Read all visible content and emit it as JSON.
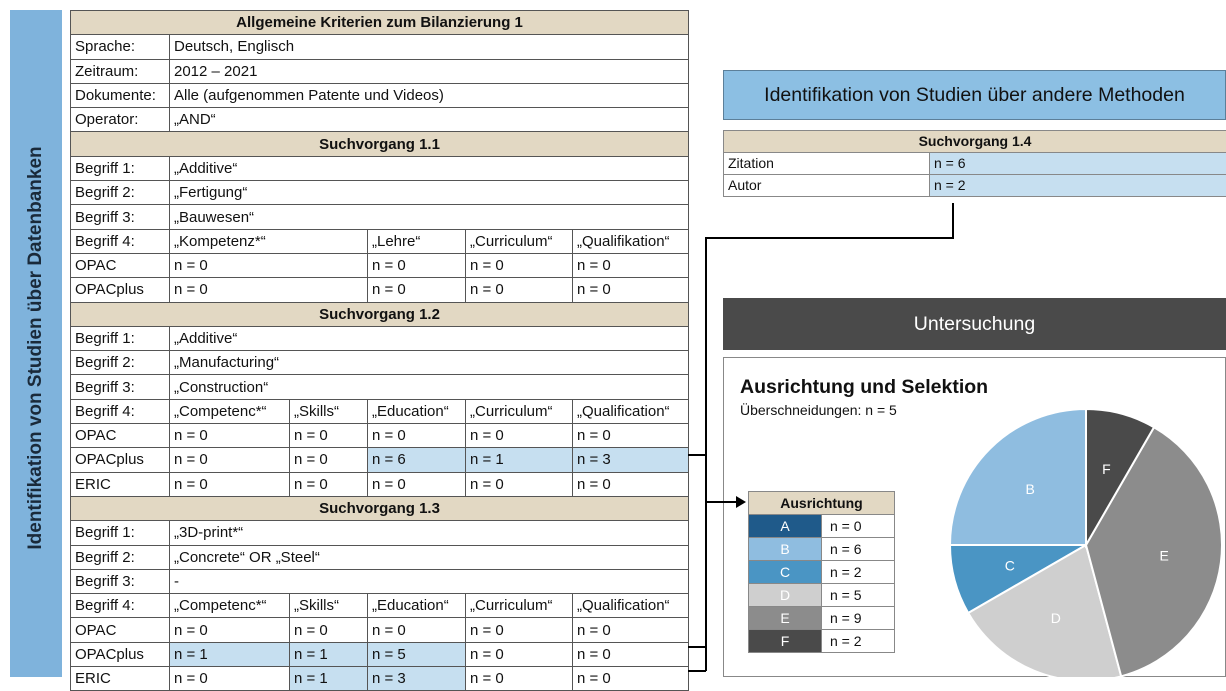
{
  "side_label": "Identifikation von Studien über Datenbanken",
  "main_table": {
    "title": "Allgemeine Kriterien zum Bilanzierung 1",
    "criteria": [
      {
        "label": "Sprache:",
        "value": "Deutsch, Englisch"
      },
      {
        "label": "Zeitraum:",
        "value": "2012 – 2021"
      },
      {
        "label": "Dokumente:",
        "value": "Alle (aufgenommen Patente und Videos)"
      },
      {
        "label": "Operator:",
        "value": "„AND“"
      }
    ],
    "sections": [
      {
        "title": "Suchvorgang 1.1",
        "terms": [
          {
            "label": "Begriff 1:",
            "value": "„Additive“"
          },
          {
            "label": "Begriff 2:",
            "value": "„Fertigung“"
          },
          {
            "label": "Begriff 3:",
            "value": "„Bauwesen“"
          }
        ],
        "term4": {
          "label": "Begriff 4:",
          "cells": [
            "„Kompetenz*“",
            "„Lehre“",
            "„Curriculum“",
            "„Qualifikation“"
          ]
        },
        "results": [
          {
            "db": "OPAC",
            "cells": [
              "n = 0",
              "n = 0",
              "n = 0",
              "n = 0"
            ]
          },
          {
            "db": "OPACplus",
            "cells": [
              "n = 0",
              "n = 0",
              "n = 0",
              "n = 0"
            ]
          }
        ]
      },
      {
        "title": "Suchvorgang 1.2",
        "terms": [
          {
            "label": "Begriff 1:",
            "value": "„Additive“"
          },
          {
            "label": "Begriff 2:",
            "value": "„Manufacturing“"
          },
          {
            "label": "Begriff 3:",
            "value": "„Construction“"
          }
        ],
        "term4": {
          "label": "Begriff 4:",
          "cells": [
            "„Competenc*“",
            "„Skills“",
            "„Education“",
            "„Curriculum“",
            "„Qualification“"
          ]
        },
        "results": [
          {
            "db": "OPAC",
            "cells": [
              "n = 0",
              "n = 0",
              "n = 0",
              "n = 0",
              "n = 0"
            ]
          },
          {
            "db": "OPACplus",
            "cells": [
              "n = 0",
              "n = 0",
              "n = 6",
              "n = 1",
              "n = 3"
            ]
          },
          {
            "db": "ERIC",
            "cells": [
              "n = 0",
              "n = 0",
              "n = 0",
              "n = 0",
              "n = 0"
            ]
          }
        ]
      },
      {
        "title": "Suchvorgang 1.3",
        "terms": [
          {
            "label": "Begriff 1:",
            "value": "„3D-print*“"
          },
          {
            "label": "Begriff 2:",
            "value": "„Concrete“ OR „Steel“"
          },
          {
            "label": "Begriff 3:",
            "value": "-"
          }
        ],
        "term4": {
          "label": "Begriff 4:",
          "cells": [
            "„Competenc*“",
            "„Skills“",
            "„Education“",
            "„Curriculum“",
            "„Qualification“"
          ]
        },
        "results": [
          {
            "db": "OPAC",
            "cells": [
              "n = 0",
              "n = 0",
              "n = 0",
              "n = 0",
              "n = 0"
            ]
          },
          {
            "db": "OPACplus",
            "cells": [
              "n = 1",
              "n = 1",
              "n = 5",
              "n = 0",
              "n = 0"
            ]
          },
          {
            "db": "ERIC",
            "cells": [
              "n = 0",
              "n = 1",
              "n = 3",
              "n = 0",
              "n = 0"
            ]
          }
        ]
      }
    ]
  },
  "other_methods": {
    "title": "Identifikation von Studien über andere Methoden",
    "search_title": "Suchvorgang 1.4",
    "rows": [
      {
        "label": "Zitation",
        "value": "n = 6"
      },
      {
        "label": "Autor",
        "value": "n = 2"
      }
    ]
  },
  "untersuchung": {
    "title": "Untersuchung",
    "subtitle": "Ausrichtung und Selektion",
    "overlap": "Überschneidungen: n = 5",
    "legend_title": "Ausrichtung",
    "legend": [
      {
        "key": "A",
        "value": "n = 0",
        "color": "#1f5a8a"
      },
      {
        "key": "B",
        "value": "n = 6",
        "color": "#8fbde0"
      },
      {
        "key": "C",
        "value": "n = 2",
        "color": "#4a95c4"
      },
      {
        "key": "D",
        "value": "n = 5",
        "color": "#cfcfcf"
      },
      {
        "key": "E",
        "value": "n = 9",
        "color": "#8c8c8c"
      },
      {
        "key": "F",
        "value": "n = 2",
        "color": "#4a4a4a"
      }
    ]
  },
  "chart_data": {
    "type": "pie",
    "categories": [
      "A",
      "B",
      "C",
      "D",
      "E",
      "F"
    ],
    "values": [
      0,
      6,
      2,
      5,
      9,
      2
    ],
    "colors": [
      "#1f5a8a",
      "#8fbde0",
      "#4a95c4",
      "#cfcfcf",
      "#8c8c8c",
      "#4a4a4a"
    ]
  }
}
